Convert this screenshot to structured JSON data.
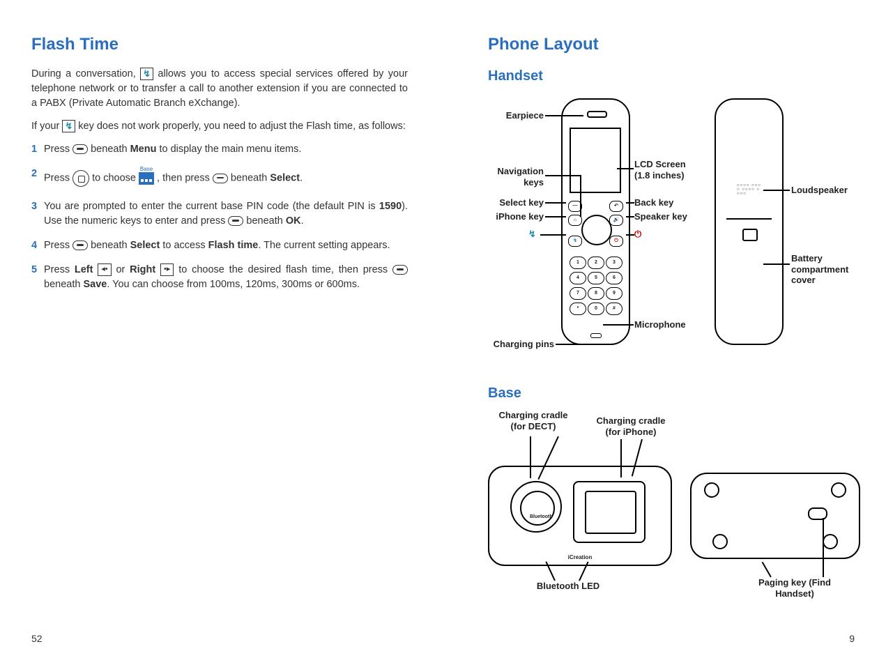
{
  "left": {
    "title": "Flash Time",
    "intro1_a": "During a conversation, ",
    "intro1_b": " allows you to access special services offered by your telephone network or to transfer a call to another extension if you are connected to a PABX (Private Automatic Branch eXchange).",
    "intro2_a": "If your ",
    "intro2_b": " key does not work properly, you need to adjust the Flash time, as follows:",
    "steps": [
      {
        "num": "1",
        "a": "Press ",
        "b": " beneath ",
        "c": "Menu",
        "d": " to display the main menu items."
      },
      {
        "num": "2",
        "a": "Press ",
        "b": " to choose ",
        "base_label": "Base",
        "c": " , then press ",
        "d": " beneath ",
        "e": "Select",
        "f": "."
      },
      {
        "num": "3",
        "a": "You are prompted to enter the current base PIN code (the default PIN is ",
        "b": "1590",
        "c": "). Use the numeric keys to enter and press ",
        "d": " beneath ",
        "e": "OK",
        "f": "."
      },
      {
        "num": "4",
        "a": "Press ",
        "b": " beneath ",
        "c": "Select",
        "d": " to access ",
        "e": "Flash time",
        "f": ". The current setting appears."
      },
      {
        "num": "5",
        "a": "Press ",
        "b": "Left",
        "c": " or ",
        "d": "Right",
        "e": " to choose the desired flash time, then press ",
        "f": " beneath ",
        "g": "Save",
        "h": ". You can choose from 100ms, 120ms, 300ms or 600ms."
      }
    ],
    "page_num": "52"
  },
  "right": {
    "title": "Phone Layout",
    "handset_title": "Handset",
    "labels": {
      "earpiece": "Earpiece",
      "nav": "Navigation keys",
      "select": "Select key",
      "iphone": "iPhone key",
      "flash": "",
      "charging": "Charging pins",
      "lcd": "LCD Screen (1.8 inches)",
      "back": "Back key",
      "speaker_key": "Speaker key",
      "mic": "Microphone",
      "loud": "Loudspeaker",
      "batt": "Battery compartment cover"
    },
    "base_title": "Base",
    "base_labels": {
      "cradle_dect": "Charging cradle (for DECT)",
      "cradle_iphone": "Charging cradle (for iPhone)",
      "bt_led": "Bluetooth LED",
      "paging": "Paging key (Find Handset)",
      "brand": "iCreation",
      "bt": "Bluetooth"
    },
    "page_num": "9"
  }
}
